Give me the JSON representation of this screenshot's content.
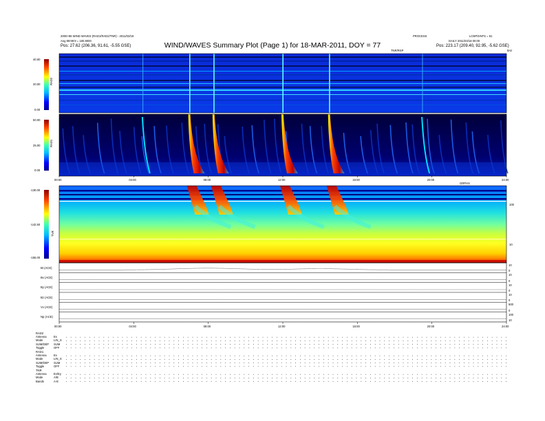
{
  "header": {
    "title": "WIND/WAVES Summary Plot (Page 1) for 18-MAR-2011, DOY = 77",
    "left_line1": "2000+86 WIND WAVES (RAD1/RAD2/TNR) - 2011/03/18",
    "left_line2": "Ang 99:99:9 = 180.9000",
    "left_line3": "Pos:   27.62 (206.36, 91.61, -5.55 GSE)",
    "right_line1": "LOSPOINTS = 81",
    "right_line1b": "PROCESS",
    "right_line2": "DAILY  2011/03/18 00:00",
    "right_line3": "Pos:   223.17 (209.40, 92.95, -5.62 GSE)",
    "top_small_left": "RAD2",
    "top_small_right": "kHz",
    "top_mid_label": "TNR/RSP"
  },
  "chart_data": [
    {
      "type": "heatmap",
      "name": "RAD2",
      "ylabel": "RAD2",
      "colorbar_ticks": [
        "40.00",
        "20.00",
        "0.00"
      ],
      "colorbar_range": [
        0,
        40
      ],
      "x_range_hours": [
        0,
        24
      ],
      "type_iii_bursts_hours": [
        4.5,
        7.0,
        8.3,
        12.0,
        14.5,
        19.5
      ]
    },
    {
      "type": "heatmap",
      "name": "RAD1",
      "ylabel": "RAD1",
      "colorbar_ticks": [
        "50.00",
        "25.00",
        "0.00"
      ],
      "colorbar_range": [
        0,
        50
      ],
      "x_range_hours": [
        0,
        24
      ],
      "xticks": [
        "00:00",
        "04:00",
        "08:00",
        "12:00",
        "16:00",
        "20:00",
        "24:00"
      ],
      "x_unit_label": "GRPHX",
      "type_iii_bursts_hours": [
        4.5,
        7.0,
        8.3,
        12.0,
        14.5,
        19.5
      ]
    },
    {
      "type": "heatmap",
      "name": "TNR",
      "ylabel": "TNR",
      "colorbar_ticks": [
        "-130.00",
        "-142.50",
        "-155.00"
      ],
      "colorbar_range": [
        -155,
        -130
      ],
      "right_axis_ticks": [
        "100",
        "10"
      ],
      "x_range_hours": [
        0,
        24
      ],
      "type_iii_bursts_hours": [
        7.0,
        8.3,
        12.0,
        14.5
      ]
    },
    {
      "type": "line",
      "panels": [
        {
          "label": "Bt (ACE)",
          "right_ticks": [
            "10",
            "0"
          ]
        },
        {
          "label": "Bx (ACE)",
          "right_ticks": [
            "10",
            "0"
          ]
        },
        {
          "label": "By (ACE)",
          "right_ticks": [
            "10",
            "0"
          ]
        },
        {
          "label": "Bz (ACE)",
          "right_ticks": [
            "10",
            "0"
          ]
        },
        {
          "label": "Vx (ACE)",
          "right_ticks": [
            "500",
            "0"
          ]
        },
        {
          "label": "Np (ACE)",
          "right_ticks": [
            "100",
            "10"
          ]
        }
      ],
      "xticks": [
        "00:00",
        "04:00",
        "08:00",
        "12:00",
        "16:00",
        "20:00",
        "24:00"
      ],
      "x_range_hours": [
        0,
        24
      ]
    }
  ],
  "footer": {
    "rad2_header": "RAD2",
    "rad2_rows": [
      {
        "label": "Antenna",
        "value": "Ex"
      },
      {
        "label": "Mode",
        "value": "LIN_S"
      },
      {
        "label": "SUM/DEP",
        "value": "SUM"
      },
      {
        "label": "Toggle",
        "value": "OFF"
      }
    ],
    "rad1_header": "RAD1",
    "rad1_rows": [
      {
        "label": "Antenna",
        "value": "Ex"
      },
      {
        "label": "Mode",
        "value": "LIN_S"
      },
      {
        "label": "SUM/DEP",
        "value": "SUM"
      },
      {
        "label": "Toggle",
        "value": "OFF"
      }
    ],
    "tnr_header": "TNR",
    "tnr_rows": [
      {
        "label": "Antenna",
        "value": "Ex/Ey"
      },
      {
        "label": "Mode",
        "value": "A/B"
      },
      {
        "label": "Bands",
        "value": "A-E"
      }
    ]
  }
}
